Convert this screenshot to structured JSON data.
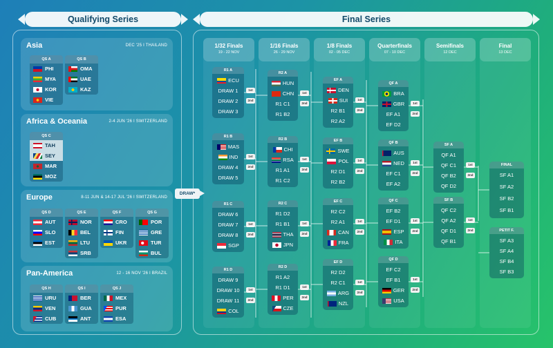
{
  "headers": {
    "qualifying": "Qualifying Series",
    "final": "Final Series",
    "draw_tag": "DRAW*"
  },
  "regions": [
    {
      "name": "Asia",
      "meta": "DEC '25 I THAILAND",
      "groups": [
        {
          "label": "QS A",
          "teams": [
            {
              "code": "PHI",
              "flag": "ph",
              "hl": false
            },
            {
              "code": "MYA",
              "flag": "mm",
              "hl": false
            },
            {
              "code": "KOR",
              "flag": "kr",
              "hl": false
            },
            {
              "code": "VIE",
              "flag": "vn",
              "hl": false
            }
          ]
        },
        {
          "label": "QS B",
          "teams": [
            {
              "code": "OMA",
              "flag": "om",
              "hl": false
            },
            {
              "code": "UAE",
              "flag": "ae",
              "hl": false
            },
            {
              "code": "KAZ",
              "flag": "kz",
              "hl": false
            }
          ]
        }
      ]
    },
    {
      "name": "Africa & Oceania",
      "meta": "2-4 JUN '26 I SWITZERLAND",
      "groups": [
        {
          "label": "QS C",
          "teams": [
            {
              "code": "TAH",
              "flag": "pf",
              "hl": true
            },
            {
              "code": "SEY",
              "flag": "sc",
              "hl": true
            },
            {
              "code": "MAR",
              "flag": "ma",
              "hl": false
            },
            {
              "code": "MOZ",
              "flag": "mz",
              "hl": false
            }
          ]
        }
      ]
    },
    {
      "name": "Europe",
      "meta": "8-11 JUN & 14-17 JUL '26 I SWITZERLAND",
      "groups": [
        {
          "label": "QS D",
          "teams": [
            {
              "code": "AUT",
              "flag": "at",
              "hl": false
            },
            {
              "code": "SLO",
              "flag": "si",
              "hl": false
            },
            {
              "code": "EST",
              "flag": "ee",
              "hl": false
            }
          ]
        },
        {
          "label": "QS E",
          "teams": [
            {
              "code": "NOR",
              "flag": "no",
              "hl": false
            },
            {
              "code": "BEL",
              "flag": "be",
              "hl": false
            },
            {
              "code": "LTU",
              "flag": "lt",
              "hl": false
            },
            {
              "code": "SRB",
              "flag": "rs",
              "hl": false
            }
          ]
        },
        {
          "label": "QS F",
          "teams": [
            {
              "code": "CRO",
              "flag": "hr",
              "hl": false
            },
            {
              "code": "FIN",
              "flag": "fi",
              "hl": false
            },
            {
              "code": "UKR",
              "flag": "ua",
              "hl": false
            }
          ]
        },
        {
          "label": "QS G",
          "teams": [
            {
              "code": "POR",
              "flag": "pt",
              "hl": false
            },
            {
              "code": "GRE",
              "flag": "gr",
              "hl": false
            },
            {
              "code": "TUR",
              "flag": "tr",
              "hl": false
            },
            {
              "code": "BUL",
              "flag": "bg",
              "hl": false
            }
          ]
        }
      ]
    },
    {
      "name": "Pan-America",
      "meta": "12 - 16 NOV '26 I BRAZIL",
      "groups": [
        {
          "label": "QS H",
          "teams": [
            {
              "code": "URU",
              "flag": "uy",
              "hl": false
            },
            {
              "code": "VEN",
              "flag": "ve",
              "hl": false
            },
            {
              "code": "CUB",
              "flag": "cu",
              "hl": false
            }
          ]
        },
        {
          "label": "QS I",
          "teams": [
            {
              "code": "BER",
              "flag": "bm",
              "hl": false
            },
            {
              "code": "GUA",
              "flag": "gt",
              "hl": false
            },
            {
              "code": "ANT",
              "flag": "ag",
              "hl": false
            }
          ]
        },
        {
          "label": "QS J",
          "teams": [
            {
              "code": "MEX",
              "flag": "mx",
              "hl": false
            },
            {
              "code": "PUR",
              "flag": "pr",
              "hl": false
            },
            {
              "code": "ESA",
              "flag": "sv",
              "hl": false
            }
          ]
        }
      ]
    }
  ],
  "rounds": [
    {
      "name": "1/32 Finals",
      "date": "19 - 22 NOV"
    },
    {
      "name": "1/16 Finals",
      "date": "26 - 29 NOV"
    },
    {
      "name": "1/8 Finals",
      "date": "02 - 05 DEC"
    },
    {
      "name": "Quarterfinals",
      "date": "07 - 10 DEC"
    },
    {
      "name": "Semifinals",
      "date": "12 DEC"
    },
    {
      "name": "Final",
      "date": "13 DEC"
    }
  ],
  "r32": [
    {
      "label": "R1 A",
      "slots": [
        {
          "t": "ECU",
          "f": "ec"
        },
        {
          "t": "DRAW 1",
          "b": "1st"
        },
        {
          "t": "DRAW 2",
          "b": "2nd"
        },
        {
          "t": "DRAW 3"
        }
      ]
    },
    {
      "label": "R1 B",
      "slots": [
        {
          "t": "MAS",
          "f": "my"
        },
        {
          "t": "IND",
          "f": "in",
          "b": "1st"
        },
        {
          "t": "DRAW 4",
          "b": "2nd"
        },
        {
          "t": "DRAW 5"
        }
      ]
    },
    {
      "label": "R1 C",
      "slots": [
        {
          "t": "DRAW 6"
        },
        {
          "t": "DRAW 7",
          "b": "1st"
        },
        {
          "t": "DRAW 8",
          "b": "2nd"
        },
        {
          "t": "SGP",
          "f": "sg"
        }
      ]
    },
    {
      "label": "R1 D",
      "slots": [
        {
          "t": "DRAW 9"
        },
        {
          "t": "DRAW 10",
          "b": "1st"
        },
        {
          "t": "DRAW 11",
          "b": "2nd"
        },
        {
          "t": "COL",
          "f": "co"
        }
      ]
    }
  ],
  "r16": [
    {
      "label": "R2 A",
      "slots": [
        {
          "t": "HUN",
          "f": "hu"
        },
        {
          "t": "CHN",
          "f": "cn",
          "b": "1st"
        },
        {
          "t": "R1 C1",
          "b": "2nd"
        },
        {
          "t": "R1 B2"
        }
      ]
    },
    {
      "label": "R2 B",
      "slots": [
        {
          "t": "CHI",
          "f": "cl"
        },
        {
          "t": "RSA",
          "f": "za",
          "b": "1st"
        },
        {
          "t": "R1 A1",
          "b": "2nd"
        },
        {
          "t": "R1 C2"
        }
      ]
    },
    {
      "label": "R2 C",
      "slots": [
        {
          "t": "R1 D2"
        },
        {
          "t": "R1 B1",
          "b": "1st"
        },
        {
          "t": "THA",
          "f": "th",
          "b": "2nd"
        },
        {
          "t": "JPN",
          "f": "jp"
        }
      ]
    },
    {
      "label": "R2 D",
      "slots": [
        {
          "t": "R1 A2"
        },
        {
          "t": "R1 D1",
          "b": "1st"
        },
        {
          "t": "PER",
          "f": "pe",
          "b": "2nd"
        },
        {
          "t": "CZE",
          "f": "cz"
        }
      ]
    }
  ],
  "r8": [
    {
      "label": "EF A",
      "slots": [
        {
          "t": "DEN",
          "f": "dk"
        },
        {
          "t": "SUI",
          "f": "ch",
          "b": "1st"
        },
        {
          "t": "R2 B1",
          "b": "2nd"
        },
        {
          "t": "R2 A2"
        }
      ]
    },
    {
      "label": "EF B",
      "slots": [
        {
          "t": "SWE",
          "f": "se"
        },
        {
          "t": "POL",
          "f": "pl",
          "b": "1st"
        },
        {
          "t": "R2 D1",
          "b": "2nd"
        },
        {
          "t": "R2 B2"
        }
      ]
    },
    {
      "label": "EF C",
      "slots": [
        {
          "t": "R2 C2"
        },
        {
          "t": "R2 A1",
          "b": "1st"
        },
        {
          "t": "CAN",
          "f": "ca",
          "b": "2nd"
        },
        {
          "t": "FRA",
          "f": "fr"
        }
      ]
    },
    {
      "label": "EF D",
      "slots": [
        {
          "t": "R2 D2"
        },
        {
          "t": "R2 C1",
          "b": "1st"
        },
        {
          "t": "ARG",
          "f": "ar",
          "b": "2nd"
        },
        {
          "t": "NZL",
          "f": "nz"
        }
      ]
    }
  ],
  "qf": [
    {
      "label": "QF A",
      "slots": [
        {
          "t": "BRA",
          "f": "br"
        },
        {
          "t": "GBR",
          "f": "gb",
          "b": "1st"
        },
        {
          "t": "EF A1",
          "b": "2nd"
        },
        {
          "t": "EF D2"
        }
      ]
    },
    {
      "label": "QF B",
      "slots": [
        {
          "t": "AUS",
          "f": "au"
        },
        {
          "t": "NED",
          "f": "nl",
          "b": "1st"
        },
        {
          "t": "EF C1",
          "b": "2nd"
        },
        {
          "t": "EF A2"
        }
      ]
    },
    {
      "label": "QF C",
      "slots": [
        {
          "t": "EF B2"
        },
        {
          "t": "EF D1",
          "b": "1st"
        },
        {
          "t": "ESP",
          "f": "es",
          "b": "2nd"
        },
        {
          "t": "ITA",
          "f": "it"
        }
      ]
    },
    {
      "label": "QF D",
      "slots": [
        {
          "t": "EF C2"
        },
        {
          "t": "EF B1",
          "b": "1st"
        },
        {
          "t": "GER",
          "f": "de",
          "b": "2nd"
        },
        {
          "t": "USA",
          "f": "us"
        }
      ]
    }
  ],
  "sf": [
    {
      "label": "SF A",
      "slots": [
        {
          "t": "QF A1"
        },
        {
          "t": "QF C1",
          "b": "1st"
        },
        {
          "t": "QF B2",
          "b": "2nd"
        },
        {
          "t": "QF D2"
        }
      ]
    },
    {
      "label": "SF B",
      "slots": [
        {
          "t": "QF C2"
        },
        {
          "t": "QF A2",
          "b": "1st"
        },
        {
          "t": "QF D1",
          "b": "2nd"
        },
        {
          "t": "QF B1"
        }
      ]
    }
  ],
  "finals": [
    {
      "label": "FINAL",
      "slots": [
        {
          "t": "SF A1"
        },
        {
          "t": "SF A2"
        },
        {
          "t": "SF B2"
        },
        {
          "t": "SF B1"
        }
      ]
    },
    {
      "label": "PETIT F.",
      "slots": [
        {
          "t": "SF A3"
        },
        {
          "t": "SF A4"
        },
        {
          "t": "SF B4"
        },
        {
          "t": "SF B3"
        }
      ]
    }
  ]
}
